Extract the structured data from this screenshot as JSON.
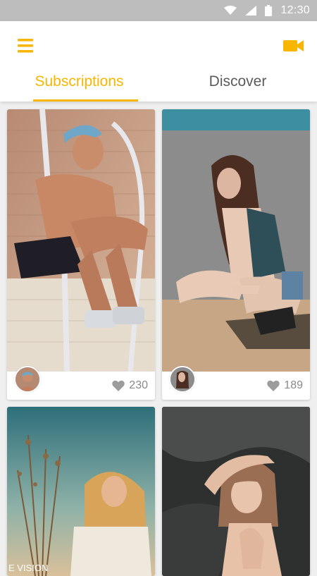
{
  "status_bar": {
    "time": "12:30",
    "icons": [
      "wifi-icon",
      "signal-icon",
      "battery-icon"
    ],
    "background": "#bdbdbd"
  },
  "app_bar": {
    "menu_icon": "hamburger-menu-icon",
    "video_icon": "video-camera-icon",
    "accent_color": "#f8b600"
  },
  "tabs": [
    {
      "label": "Subscriptions",
      "active": true
    },
    {
      "label": "Discover",
      "active": false
    }
  ],
  "feed": [
    {
      "likes": "230",
      "photo": "young man with bandana sitting on ladder railing",
      "avatar": "user avatar"
    },
    {
      "likes": "189",
      "photo": "woman with long hair crouching against stucco wall",
      "avatar": "user avatar"
    },
    {
      "likes": "",
      "photo": "blonde woman holding dry grass in field",
      "avatar": ""
    },
    {
      "likes": "",
      "photo": "girl with bangs posing against dark rock",
      "avatar": ""
    }
  ],
  "photo_text": {
    "card3_caption": "E VISION"
  }
}
